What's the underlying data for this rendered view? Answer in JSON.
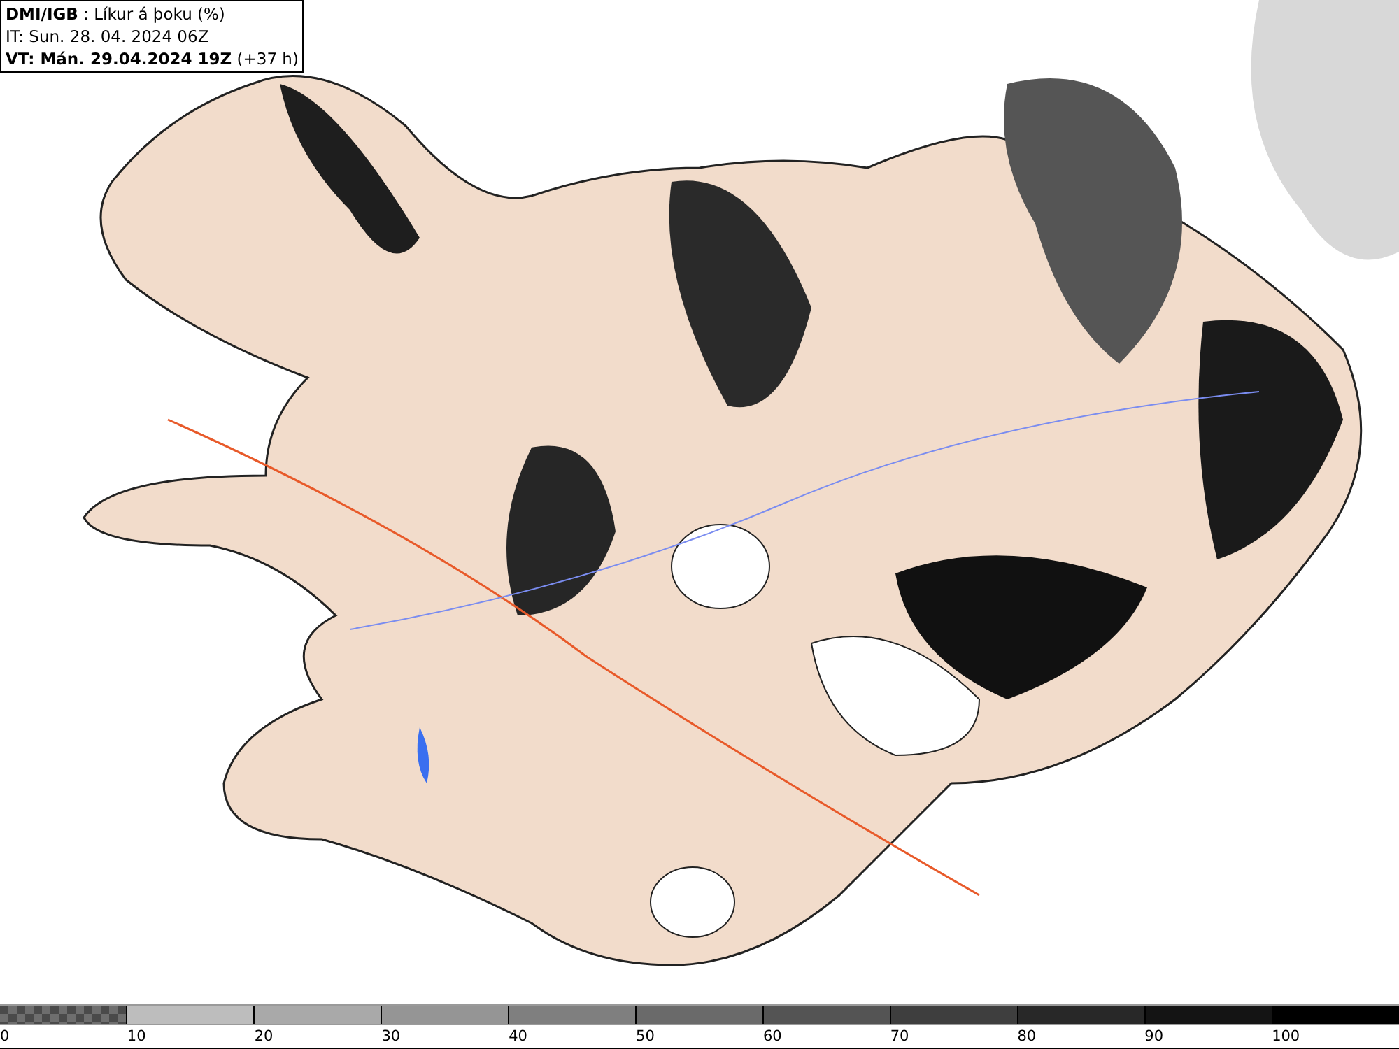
{
  "header": {
    "title_line": "**DMI/IGB** : Líkur á þoku (%)",
    "issue_line": "IT: Sun. 28. 04. 2024 06Z",
    "valid_line": "**VT: Mán. 29.04.2024 19Z** (+37 h)"
  },
  "legend": {
    "swatches": [
      {
        "kind": "checker",
        "color": "#6e6e6e"
      },
      {
        "kind": "solid",
        "color": "#bdbdbd"
      },
      {
        "kind": "solid",
        "color": "#a9a9a9"
      },
      {
        "kind": "solid",
        "color": "#959595"
      },
      {
        "kind": "solid",
        "color": "#7f7f7f"
      },
      {
        "kind": "solid",
        "color": "#6a6a6a"
      },
      {
        "kind": "solid",
        "color": "#545454"
      },
      {
        "kind": "solid",
        "color": "#3e3e3e"
      },
      {
        "kind": "solid",
        "color": "#282828"
      },
      {
        "kind": "solid",
        "color": "#141414"
      },
      {
        "kind": "solid",
        "color": "#000000"
      }
    ],
    "ticks": [
      "0",
      "10",
      "20",
      "30",
      "40",
      "50",
      "60",
      "70",
      "80",
      "90",
      "100"
    ]
  }
}
